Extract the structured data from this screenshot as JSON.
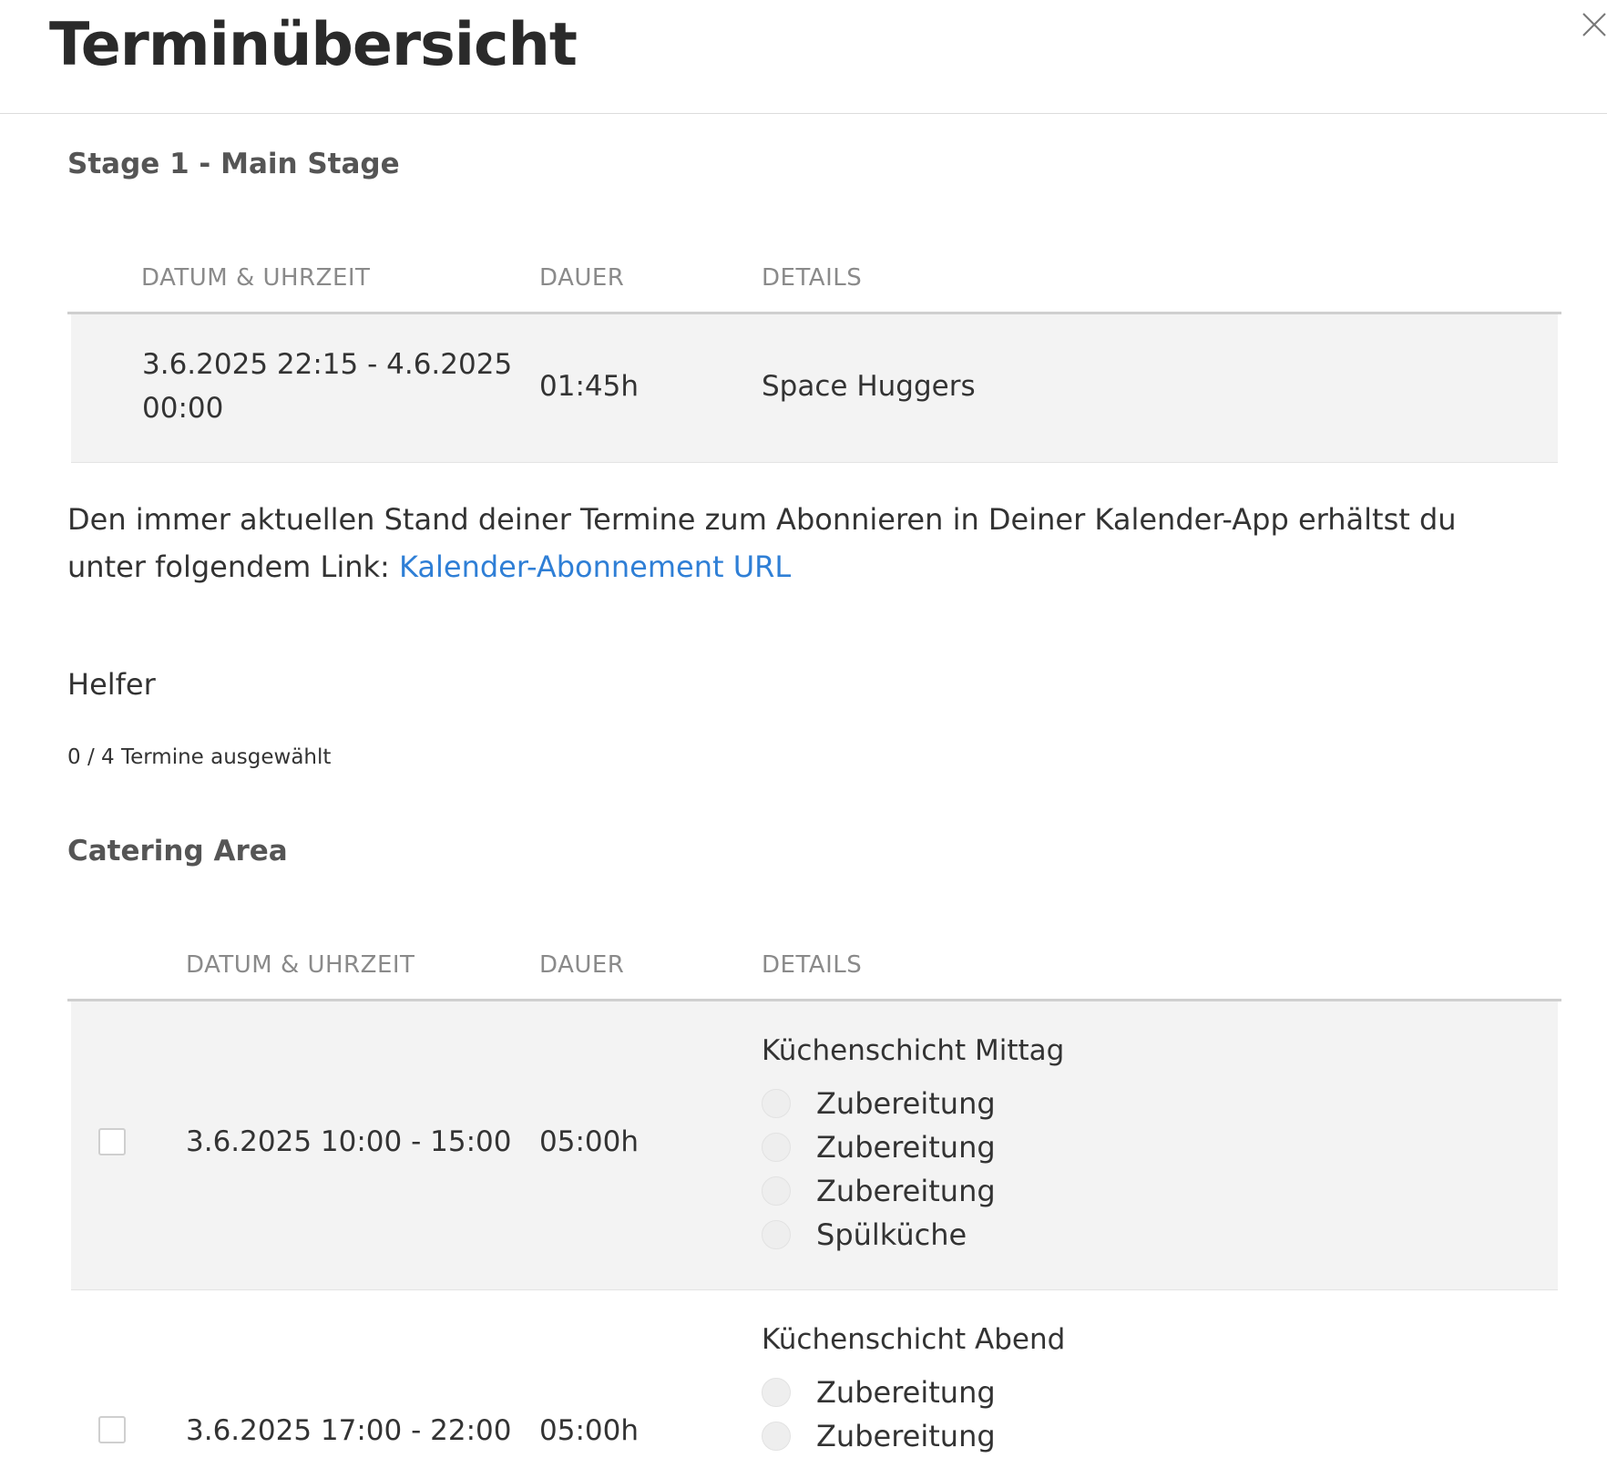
{
  "header": {
    "title": "Terminübersicht"
  },
  "stage": {
    "title": "Stage 1 - Main Stage",
    "columns": [
      "DATUM & UHRZEIT",
      "DAUER",
      "DETAILS"
    ],
    "row": {
      "date_line1": "3.6.2025 22:15 - 4.6.2025",
      "date_line2": "00:00",
      "duration": "01:45h",
      "details": "Space Huggers"
    }
  },
  "info": {
    "text": "Den immer aktuellen Stand deiner Termine zum Abonnieren in Deiner Kalender-App erhältst du unter folgendem Link: ",
    "link_label": "Kalender-Abonnement URL"
  },
  "helpers": {
    "title": "Helfer",
    "selected_count": "0 / 4 Termine ausgewählt"
  },
  "catering": {
    "title": "Catering Area",
    "columns": [
      "DATUM & UHRZEIT",
      "DAUER",
      "DETAILS"
    ],
    "shifts": [
      {
        "date": "3.6.2025 10:00 - 15:00",
        "duration": "05:00h",
        "title": "Küchenschicht Mittag",
        "roles": [
          "Zubereitung",
          "Zubereitung",
          "Zubereitung",
          "Spülküche"
        ]
      },
      {
        "date": "3.6.2025 17:00 - 22:00",
        "duration": "05:00h",
        "title": "Küchenschicht Abend",
        "roles": [
          "Zubereitung",
          "Zubereitung"
        ]
      }
    ]
  }
}
